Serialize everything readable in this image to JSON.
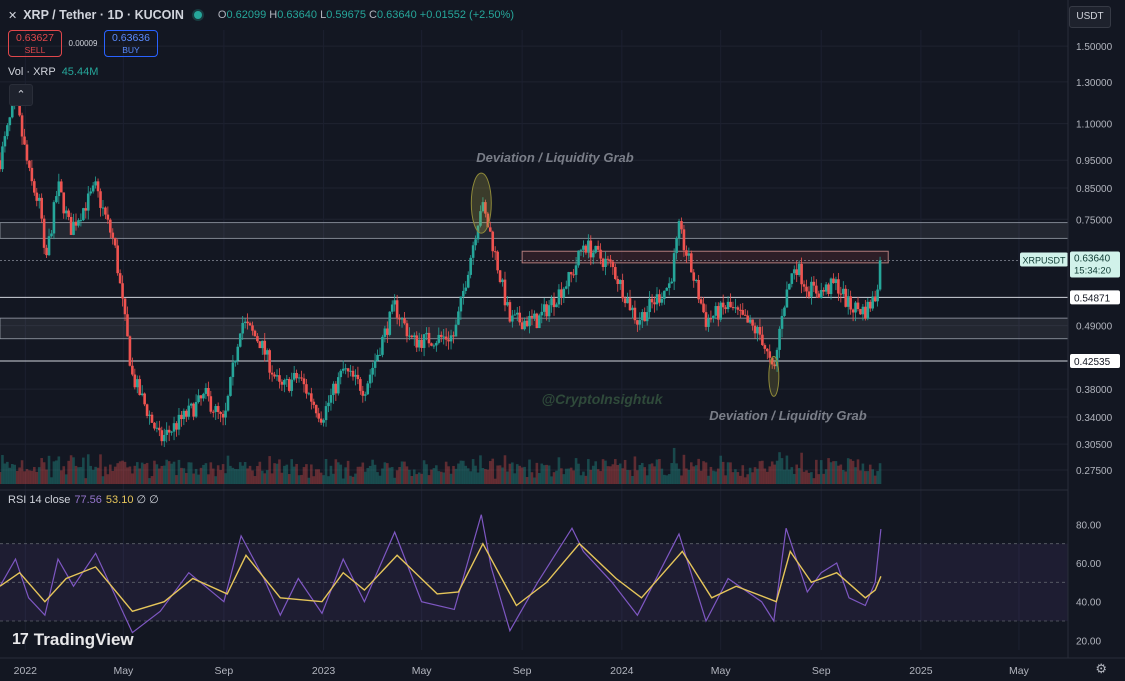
{
  "header": {
    "symbol": "XRP / Tether · 1D · KUCOIN",
    "open_label": "O",
    "open": "0.62099",
    "high_label": "H",
    "high": "0.63640",
    "low_label": "L",
    "low": "0.59675",
    "close_label": "C",
    "close": "0.63640",
    "change": "+0.01552 (+2.50%)"
  },
  "trade": {
    "sell_price": "0.63627",
    "sell_label": "SELL",
    "spread": "0.00009",
    "buy_price": "0.63636",
    "buy_label": "BUY"
  },
  "volume": {
    "label": "Vol · XRP",
    "value": "45.44M"
  },
  "currency_button": "USDT",
  "rsi_header": {
    "label": "RSI 14 close",
    "rsi": "77.56",
    "ma": "53.10",
    "extra": "∅ ∅"
  },
  "brand": "TradingView",
  "icons": {
    "symbol": "xrp-icon",
    "collapse": "chevron-up-icon",
    "settings": "gear-icon",
    "status": "status-dot-icon"
  },
  "colors": {
    "background": "#131722",
    "up": "#26a69a",
    "down": "#ef5350",
    "rsi": "#7e57c2",
    "rsi_ma": "#e5c55a",
    "sell": "#e0474b",
    "buy": "#2962ff"
  },
  "chart_data": [
    {
      "type": "candlestick",
      "title": "XRP / Tether · 1D · KUCOIN",
      "scale": "log",
      "price_axis_ticks": [
        "1.50000",
        "1.30000",
        "1.10000",
        "0.95000",
        "0.85000",
        "0.75000",
        "0.49000",
        "0.38000",
        "0.34000",
        "0.30500",
        "0.27500"
      ],
      "time_axis_ticks": [
        "2022",
        "May",
        "Sep",
        "2023",
        "May",
        "Sep",
        "2024",
        "May",
        "Sep",
        "2025",
        "May"
      ],
      "price_labels": [
        {
          "symbol": "XRPUSDT",
          "price": "0.63640",
          "countdown": "15:34:20"
        },
        {
          "price": "0.54871"
        },
        {
          "price": "0.42535"
        }
      ],
      "annotations": [
        "Deviation / Liquidity Grab",
        "Deviation / Liquidity Grab"
      ],
      "watermark": "@CryptoInsightuk",
      "zones": [
        {
          "kind": "resistance",
          "from": 0.695,
          "to": 0.74
        },
        {
          "kind": "highlight",
          "from": 0.63,
          "to": 0.66
        },
        {
          "kind": "support",
          "from": 0.465,
          "to": 0.505
        }
      ],
      "horizontal_lines": [
        0.54871,
        0.42535
      ],
      "ylim": [
        0.26,
        1.6
      ],
      "xlim": [
        "2021-12-01",
        "2025-06-30"
      ],
      "close_path": [
        {
          "date": "2021-12-01",
          "close": 0.95
        },
        {
          "date": "2021-12-20",
          "close": 1.22
        },
        {
          "date": "2021-12-28",
          "close": 1.05
        },
        {
          "date": "2022-01-07",
          "close": 0.88
        },
        {
          "date": "2022-01-20",
          "close": 0.78
        },
        {
          "date": "2022-01-25",
          "close": 0.62
        },
        {
          "date": "2022-02-10",
          "close": 0.86
        },
        {
          "date": "2022-02-25",
          "close": 0.72
        },
        {
          "date": "2022-03-28",
          "close": 0.85
        },
        {
          "date": "2022-04-20",
          "close": 0.68
        },
        {
          "date": "2022-05-12",
          "close": 0.4
        },
        {
          "date": "2022-06-15",
          "close": 0.31
        },
        {
          "date": "2022-07-05",
          "close": 0.33
        },
        {
          "date": "2022-08-10",
          "close": 0.37
        },
        {
          "date": "2022-09-01",
          "close": 0.33
        },
        {
          "date": "2022-09-22",
          "close": 0.5
        },
        {
          "date": "2022-10-15",
          "close": 0.46
        },
        {
          "date": "2022-11-09",
          "close": 0.38
        },
        {
          "date": "2022-12-01",
          "close": 0.4
        },
        {
          "date": "2022-12-30",
          "close": 0.34
        },
        {
          "date": "2023-01-25",
          "close": 0.41
        },
        {
          "date": "2023-02-20",
          "close": 0.38
        },
        {
          "date": "2023-03-29",
          "close": 0.53
        },
        {
          "date": "2023-04-20",
          "close": 0.46
        },
        {
          "date": "2023-06-10",
          "close": 0.47
        },
        {
          "date": "2023-07-13",
          "close": 0.8
        },
        {
          "date": "2023-07-25",
          "close": 0.7
        },
        {
          "date": "2023-08-17",
          "close": 0.5
        },
        {
          "date": "2023-09-20",
          "close": 0.5
        },
        {
          "date": "2023-11-01",
          "close": 0.6
        },
        {
          "date": "2023-11-15",
          "close": 0.68
        },
        {
          "date": "2023-12-20",
          "close": 0.62
        },
        {
          "date": "2024-01-20",
          "close": 0.5
        },
        {
          "date": "2024-02-29",
          "close": 0.58
        },
        {
          "date": "2024-03-11",
          "close": 0.72
        },
        {
          "date": "2024-03-25",
          "close": 0.62
        },
        {
          "date": "2024-04-13",
          "close": 0.5
        },
        {
          "date": "2024-05-10",
          "close": 0.53
        },
        {
          "date": "2024-06-20",
          "close": 0.47
        },
        {
          "date": "2024-07-05",
          "close": 0.4
        },
        {
          "date": "2024-07-15",
          "close": 0.52
        },
        {
          "date": "2024-07-31",
          "close": 0.63
        },
        {
          "date": "2024-08-15",
          "close": 0.57
        },
        {
          "date": "2024-09-01",
          "close": 0.56
        },
        {
          "date": "2024-09-20",
          "close": 0.58
        },
        {
          "date": "2024-10-05",
          "close": 0.53
        },
        {
          "date": "2024-10-25",
          "close": 0.52
        },
        {
          "date": "2024-11-06",
          "close": 0.55
        },
        {
          "date": "2024-11-13",
          "close": 0.636
        }
      ]
    },
    {
      "type": "line",
      "title": "RSI 14 close",
      "ylim": [
        15,
        90
      ],
      "axis_ticks": [
        "80.00",
        "60.00",
        "40.00",
        "20.00"
      ],
      "band": [
        30,
        70
      ],
      "series": [
        {
          "name": "RSI",
          "color": "#7e57c2",
          "points": [
            {
              "date": "2021-12-01",
              "value": 48
            },
            {
              "date": "2021-12-20",
              "value": 62
            },
            {
              "date": "2022-01-05",
              "value": 42
            },
            {
              "date": "2022-01-25",
              "value": 33
            },
            {
              "date": "2022-02-10",
              "value": 62
            },
            {
              "date": "2022-03-01",
              "value": 48
            },
            {
              "date": "2022-03-28",
              "value": 65
            },
            {
              "date": "2022-05-12",
              "value": 24
            },
            {
              "date": "2022-06-15",
              "value": 35
            },
            {
              "date": "2022-07-20",
              "value": 55
            },
            {
              "date": "2022-09-01",
              "value": 40
            },
            {
              "date": "2022-09-22",
              "value": 74
            },
            {
              "date": "2022-10-20",
              "value": 52
            },
            {
              "date": "2022-11-09",
              "value": 33
            },
            {
              "date": "2022-12-01",
              "value": 52
            },
            {
              "date": "2022-12-30",
              "value": 34
            },
            {
              "date": "2023-01-25",
              "value": 62
            },
            {
              "date": "2023-02-20",
              "value": 40
            },
            {
              "date": "2023-03-29",
              "value": 76
            },
            {
              "date": "2023-05-01",
              "value": 40
            },
            {
              "date": "2023-06-10",
              "value": 36
            },
            {
              "date": "2023-07-13",
              "value": 85
            },
            {
              "date": "2023-07-25",
              "value": 58
            },
            {
              "date": "2023-08-17",
              "value": 25
            },
            {
              "date": "2023-09-20",
              "value": 50
            },
            {
              "date": "2023-11-01",
              "value": 78
            },
            {
              "date": "2023-11-15",
              "value": 66
            },
            {
              "date": "2023-12-20",
              "value": 50
            },
            {
              "date": "2024-01-20",
              "value": 33
            },
            {
              "date": "2024-03-11",
              "value": 75
            },
            {
              "date": "2024-04-13",
              "value": 30
            },
            {
              "date": "2024-05-10",
              "value": 52
            },
            {
              "date": "2024-06-20",
              "value": 40
            },
            {
              "date": "2024-07-05",
              "value": 30
            },
            {
              "date": "2024-07-20",
              "value": 78
            },
            {
              "date": "2024-08-15",
              "value": 45
            },
            {
              "date": "2024-09-01",
              "value": 55
            },
            {
              "date": "2024-09-20",
              "value": 60
            },
            {
              "date": "2024-10-05",
              "value": 42
            },
            {
              "date": "2024-10-25",
              "value": 38
            },
            {
              "date": "2024-11-06",
              "value": 50
            },
            {
              "date": "2024-11-13",
              "value": 77.56
            }
          ]
        },
        {
          "name": "RSI MA",
          "color": "#e5c55a",
          "points": [
            {
              "date": "2021-12-01",
              "value": 48
            },
            {
              "date": "2021-12-25",
              "value": 55
            },
            {
              "date": "2022-01-25",
              "value": 40
            },
            {
              "date": "2022-02-20",
              "value": 52
            },
            {
              "date": "2022-03-28",
              "value": 58
            },
            {
              "date": "2022-05-12",
              "value": 35
            },
            {
              "date": "2022-06-20",
              "value": 40
            },
            {
              "date": "2022-07-25",
              "value": 52
            },
            {
              "date": "2022-09-05",
              "value": 44
            },
            {
              "date": "2022-09-28",
              "value": 64
            },
            {
              "date": "2022-11-09",
              "value": 42
            },
            {
              "date": "2022-12-30",
              "value": 40
            },
            {
              "date": "2023-01-25",
              "value": 55
            },
            {
              "date": "2023-02-20",
              "value": 46
            },
            {
              "date": "2023-04-01",
              "value": 64
            },
            {
              "date": "2023-05-20",
              "value": 44
            },
            {
              "date": "2023-06-15",
              "value": 45
            },
            {
              "date": "2023-07-15",
              "value": 70
            },
            {
              "date": "2023-08-25",
              "value": 38
            },
            {
              "date": "2023-10-01",
              "value": 50
            },
            {
              "date": "2023-11-10",
              "value": 70
            },
            {
              "date": "2023-12-25",
              "value": 52
            },
            {
              "date": "2024-01-25",
              "value": 42
            },
            {
              "date": "2024-03-15",
              "value": 66
            },
            {
              "date": "2024-04-20",
              "value": 42
            },
            {
              "date": "2024-05-20",
              "value": 48
            },
            {
              "date": "2024-07-08",
              "value": 40
            },
            {
              "date": "2024-07-25",
              "value": 66
            },
            {
              "date": "2024-08-20",
              "value": 50
            },
            {
              "date": "2024-09-20",
              "value": 55
            },
            {
              "date": "2024-10-25",
              "value": 42
            },
            {
              "date": "2024-11-06",
              "value": 46
            },
            {
              "date": "2024-11-13",
              "value": 53.1
            }
          ]
        }
      ]
    }
  ]
}
